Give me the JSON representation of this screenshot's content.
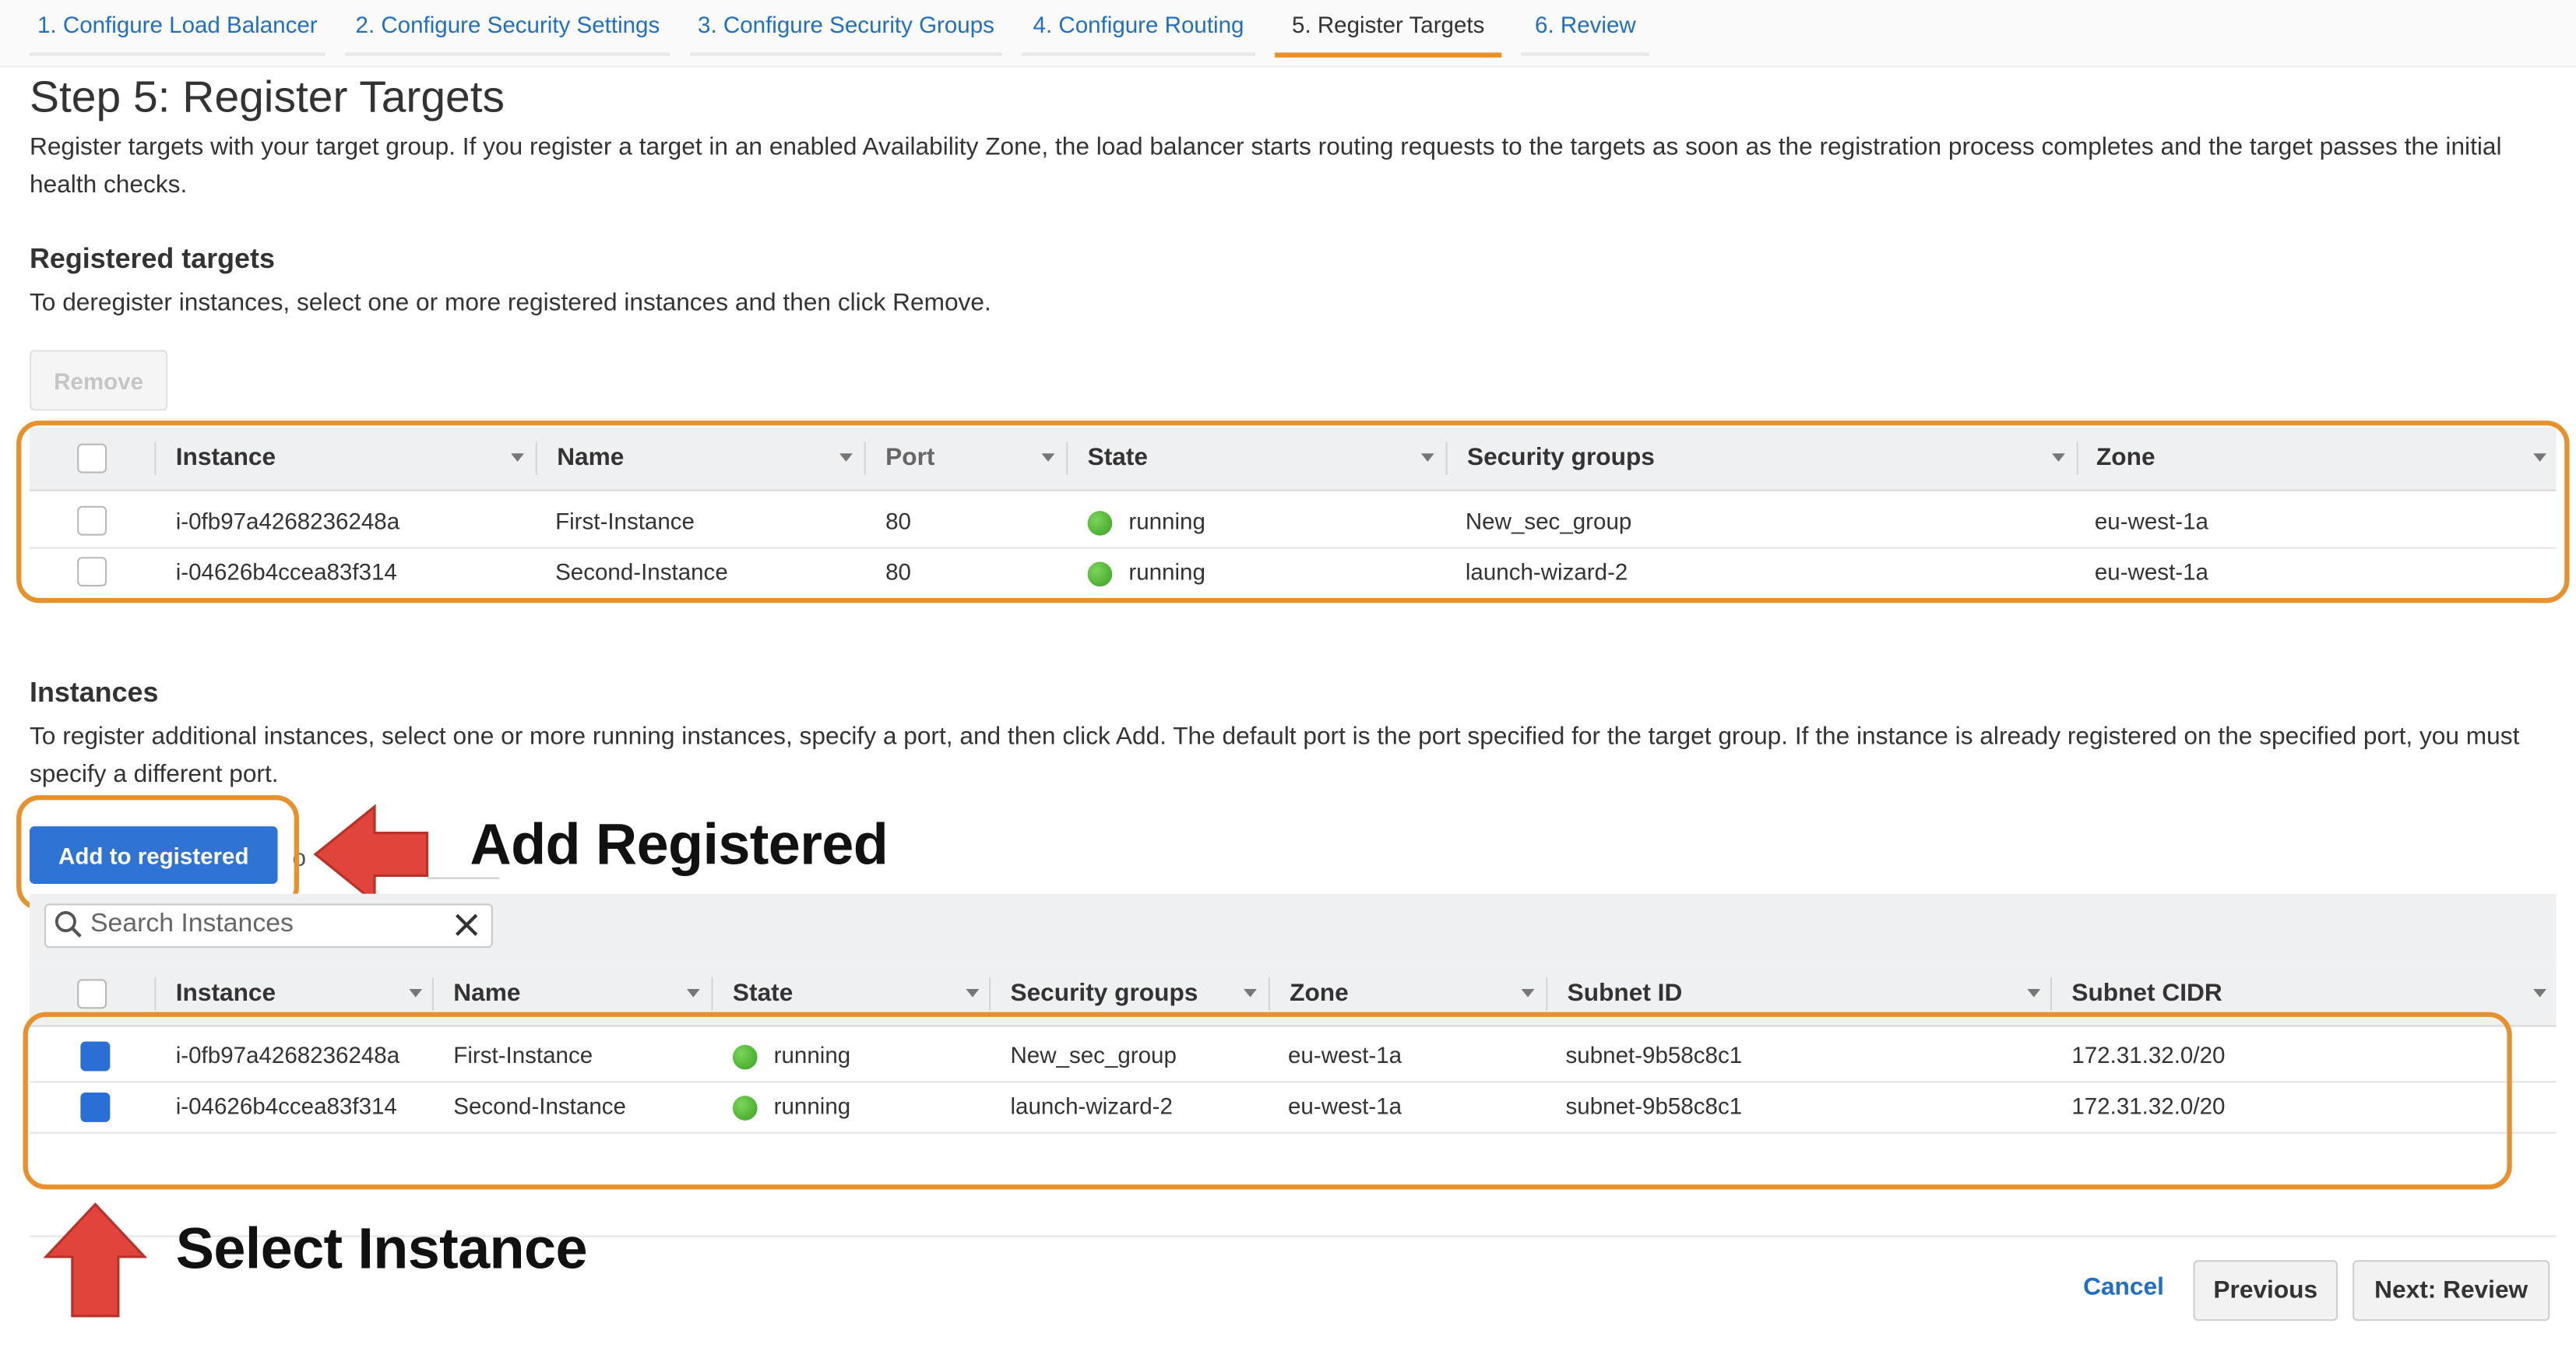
{
  "wizard_tabs": [
    {
      "label": "1. Configure Load Balancer"
    },
    {
      "label": "2. Configure Security Settings"
    },
    {
      "label": "3. Configure Security Groups"
    },
    {
      "label": "4. Configure Routing"
    },
    {
      "label": "5. Register Targets",
      "active": true
    },
    {
      "label": "6. Review"
    }
  ],
  "page": {
    "title": "Step 5: Register Targets",
    "description": "Register targets with your target group. If you register a target in an enabled Availability Zone, the load balancer starts routing requests to the targets as soon as the registration process completes and the target passes the initial health checks."
  },
  "registered": {
    "heading": "Registered targets",
    "help": "To deregister instances, select one or more registered instances and then click Remove.",
    "remove_label": "Remove",
    "columns": [
      "Instance",
      "Name",
      "Port",
      "State",
      "Security groups",
      "Zone"
    ],
    "rows": [
      {
        "instance": "i-0fb97a4268236248a",
        "name": "First-Instance",
        "port": "80",
        "state": "running",
        "security_group": "New_sec_group",
        "zone": "eu-west-1a"
      },
      {
        "instance": "i-04626b4ccea83f314",
        "name": "Second-Instance",
        "port": "80",
        "state": "running",
        "security_group": "launch-wizard-2",
        "zone": "eu-west-1a"
      }
    ]
  },
  "instances": {
    "heading": "Instances",
    "help": "To register additional instances, select one or more running instances, specify a port, and then click Add. The default port is the port specified for the target group. If the instance is already registered on the specified port, you must specify a different port.",
    "add_label": "Add to registered",
    "search_placeholder": "Search Instances",
    "columns": [
      "Instance",
      "Name",
      "State",
      "Security groups",
      "Zone",
      "Subnet ID",
      "Subnet CIDR"
    ],
    "rows": [
      {
        "instance": "i-0fb97a4268236248a",
        "name": "First-Instance",
        "state": "running",
        "security_group": "New_sec_group",
        "zone": "eu-west-1a",
        "subnet_id": "subnet-9b58c8c1",
        "subnet_cidr": "172.31.32.0/20",
        "selected": true
      },
      {
        "instance": "i-04626b4ccea83f314",
        "name": "Second-Instance",
        "state": "running",
        "security_group": "launch-wizard-2",
        "zone": "eu-west-1a",
        "subnet_id": "subnet-9b58c8c1",
        "subnet_cidr": "172.31.32.0/20",
        "selected": true
      }
    ]
  },
  "annotations": {
    "add_registered": "Add Registered",
    "select_instance": "Select Instance"
  },
  "footer": {
    "cancel_label": "Cancel",
    "previous_label": "Previous",
    "next_label": "Next: Review"
  },
  "colors": {
    "accent": "#e8912c",
    "link": "#1f6fc5",
    "primary_button": "#2f73d4",
    "arrow": "#e0443a",
    "status_running": "#3a9e22"
  }
}
